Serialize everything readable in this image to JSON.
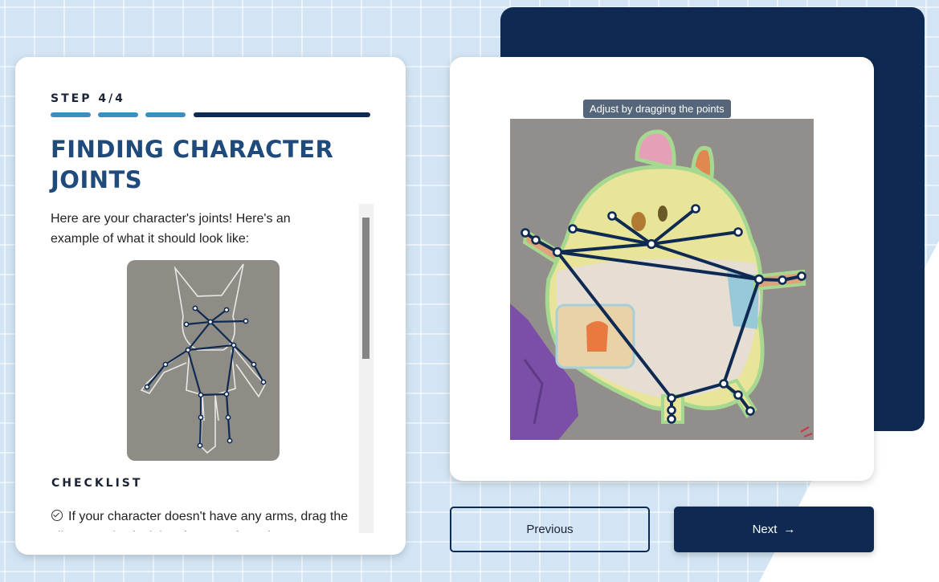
{
  "step": {
    "label": "STEP 4/4",
    "total": 4,
    "current": 4
  },
  "title": "FINDING CHARACTER JOINTS",
  "intro": "Here are your character's joints! Here's an example of what it should look like:",
  "checklist": {
    "heading": "CHECKLIST",
    "items": [
      "If your character doesn't have any arms, drag the elbows and wrist joints far away from the"
    ]
  },
  "editor": {
    "tooltip": "Adjust by dragging the points"
  },
  "buttons": {
    "previous": "Previous",
    "next": "Next",
    "next_icon": "arrow-right-icon"
  },
  "colors": {
    "accent_dark": "#0e2a52",
    "progress_done": "#3a8ec0",
    "title": "#1f4a7c",
    "background": "#d3e5f4",
    "character_fill": "#e8e59a",
    "character_outline": "#a6d890",
    "joint_line": "#0e2a52"
  }
}
